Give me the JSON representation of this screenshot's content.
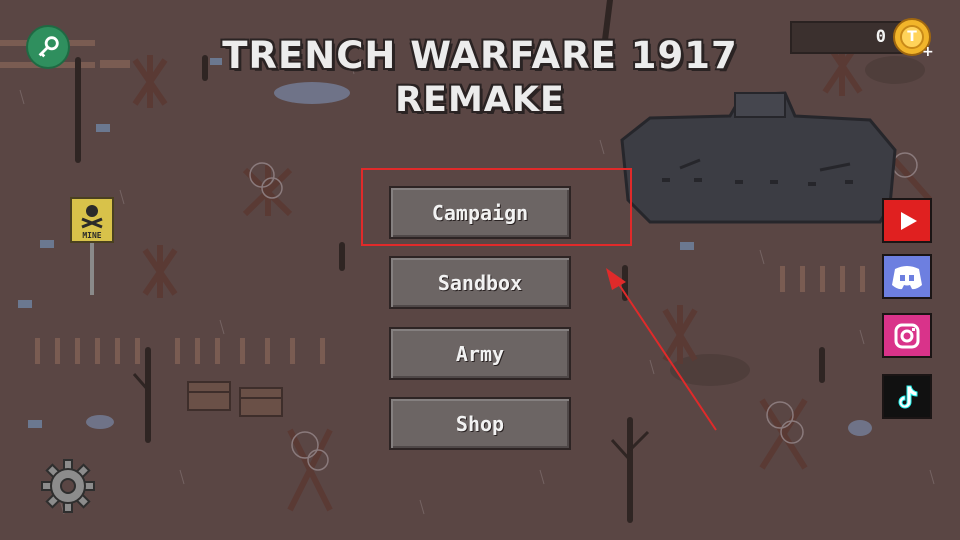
{
  "game": {
    "title_line1": "TRENCH WARFARE 1917",
    "title_line2": "REMAKE"
  },
  "menu": {
    "buttons": [
      {
        "label": "Campaign"
      },
      {
        "label": "Sandbox"
      },
      {
        "label": "Army"
      },
      {
        "label": "Shop"
      }
    ]
  },
  "currency": {
    "amount": "0",
    "coin_symbol": "T",
    "plus": "+"
  },
  "sign": {
    "text": "MINE"
  },
  "social": [
    "youtube-icon",
    "discord-icon",
    "instagram-icon",
    "tiktok-icon"
  ],
  "colors": {
    "ground": "#5a4644",
    "button": "#6c6564",
    "highlight": "#e02a2a",
    "coin": "#f2b52a",
    "youtube": "#e02020",
    "discord": "#6d7fe0",
    "instagram": "#d9338a",
    "tiktok": "#111111",
    "key_button": "#2f8f5e"
  }
}
